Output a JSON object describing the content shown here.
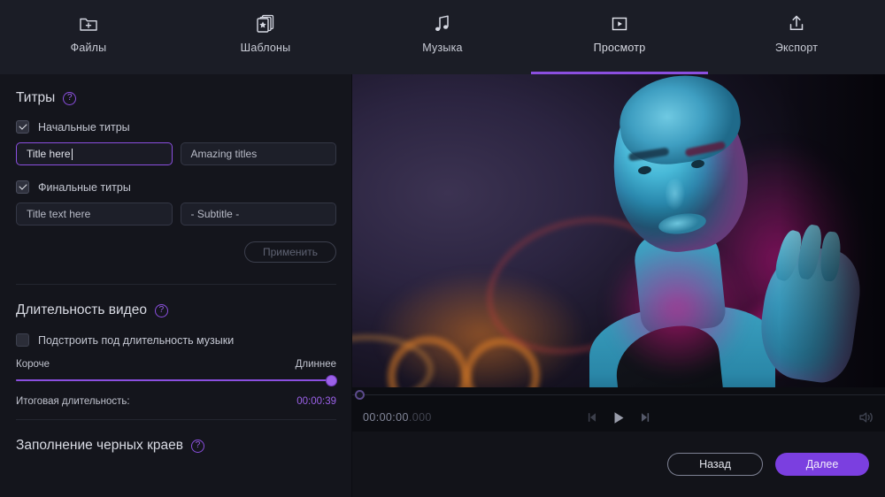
{
  "tabs": [
    {
      "label": "Файлы",
      "icon": "folder-plus-icon",
      "active": false
    },
    {
      "label": "Шаблоны",
      "icon": "template-star-icon",
      "active": false
    },
    {
      "label": "Музыка",
      "icon": "music-note-icon",
      "active": false
    },
    {
      "label": "Просмотр",
      "icon": "preview-play-icon",
      "active": true
    },
    {
      "label": "Экспорт",
      "icon": "export-upload-icon",
      "active": false
    }
  ],
  "titles_section": {
    "heading": "Титры",
    "help_glyph": "?",
    "opening": {
      "checkbox_label": "Начальные титры",
      "checked": true,
      "title_value": "Title here",
      "title_placeholder": "Title here",
      "subtitle_value": "Amazing titles",
      "subtitle_placeholder": "Amazing titles"
    },
    "closing": {
      "checkbox_label": "Финальные титры",
      "checked": true,
      "title_value": "Title text here",
      "title_placeholder": "Title text here",
      "subtitle_value": "- Subtitle -",
      "subtitle_placeholder": "- Subtitle -"
    },
    "apply_label": "Применить"
  },
  "duration_section": {
    "heading": "Длительность видео",
    "help_glyph": "?",
    "fit_music_label": "Подстроить под длительность музыки",
    "fit_music_checked": false,
    "slider_min_label": "Короче",
    "slider_max_label": "Длиннее",
    "slider_percent": 100,
    "total_label": "Итоговая длительность:",
    "total_value": "00:00:39"
  },
  "black_edges_section": {
    "heading": "Заполнение черных краев",
    "help_glyph": "?"
  },
  "player": {
    "timecode": "00:00:00",
    "timecode_ms": ".000",
    "prev_frame": "prev-frame-button",
    "play": "play-button",
    "next_frame": "next-frame-button",
    "volume": "volume-button"
  },
  "footer": {
    "back_label": "Назад",
    "next_label": "Далее"
  },
  "colors": {
    "accent_purple": "#8b4fe0",
    "next_button": "#7b3fe0",
    "topbar_bg": "#1b1d26",
    "panel_bg": "#14151c",
    "app_bg": "#121319"
  }
}
